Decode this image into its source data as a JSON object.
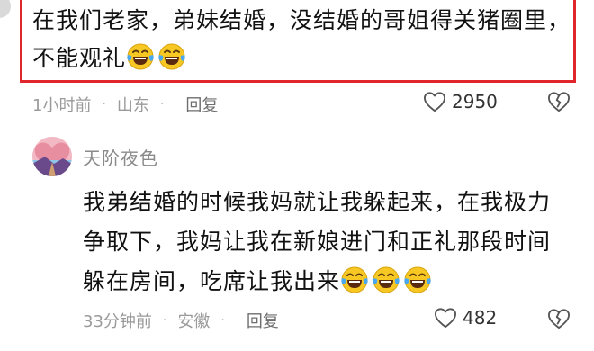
{
  "comments": [
    {
      "text": "在我们老家，弟妹结婚，没结婚的哥姐得关猪圈里，不能观礼",
      "emojis": [
        "laugh-cry-emoji",
        "laugh-cry-emoji"
      ],
      "time": "1小时前",
      "location": "山东",
      "reply_label": "回复",
      "likes": "2950",
      "highlight_color": "#e0262b"
    },
    {
      "username": "天阶夜色",
      "text": "我弟结婚的时候我妈就让我躲起来，在我极力争取下，我妈让我在新娘进门和正礼那段时间躲在房间，吃席让我出来",
      "emojis": [
        "laugh-cry-emoji",
        "laugh-cry-emoji",
        "laugh-cry-emoji"
      ],
      "time": "33分钟前",
      "location": "安徽",
      "reply_label": "回复",
      "likes": "482"
    }
  ],
  "separator": "·",
  "icons": {
    "like": "heart-outline-icon",
    "dislike": "broken-heart-icon",
    "avatar": "avatar-image"
  },
  "colors": {
    "highlight": "#e0262b",
    "meta_text": "#9a9a9a",
    "username": "#8a8a8a"
  }
}
